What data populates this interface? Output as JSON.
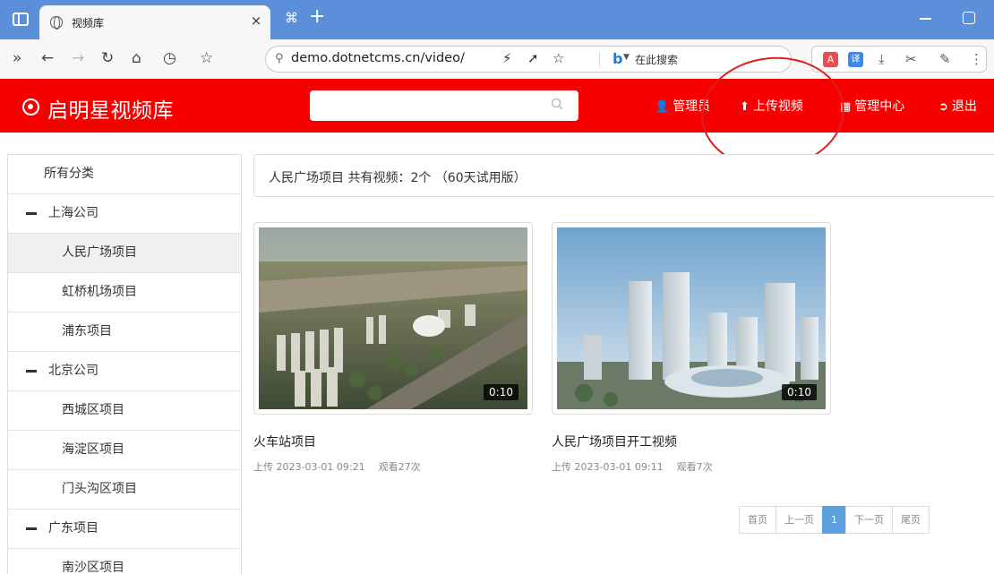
{
  "browser": {
    "tab_title": "视频库",
    "tab_close": "×",
    "new_tab": "+",
    "address_url": "demo.dotnetcms.cn/video/",
    "search_engine_text": "在此搜索"
  },
  "site": {
    "logo_text": "启明星视频库",
    "search_placeholder": "",
    "nav": [
      {
        "label": "管理员",
        "icon": "user-icon"
      },
      {
        "label": "上传视频",
        "icon": "upload-icon"
      },
      {
        "label": "管理中心",
        "icon": "dashboard-icon"
      },
      {
        "label": "退出",
        "icon": "logout-icon"
      }
    ]
  },
  "sidebar": {
    "all": "所有分类",
    "groups": [
      {
        "label": "上海公司",
        "items": [
          "人民广场项目",
          "虹桥机场项目",
          "浦东项目"
        ]
      },
      {
        "label": "北京公司",
        "items": [
          "西城区项目",
          "海淀区项目",
          "门头沟区项目"
        ]
      },
      {
        "label": "广东项目",
        "items": [
          "南沙区项目"
        ]
      }
    ],
    "active_item": "人民广场项目"
  },
  "main": {
    "crumb": "人民广场项目 共有视频：2个 （60天试用版）",
    "videos": [
      {
        "title": "火车站项目",
        "duration": "0:10",
        "uploaded": "上传 2023-03-01 09:21",
        "views": "观看27次"
      },
      {
        "title": "人民广场项目开工视频",
        "duration": "0:10",
        "uploaded": "上传 2023-03-01 09:11",
        "views": "观看7次"
      }
    ],
    "pager": {
      "first": "首页",
      "prev": "上一页",
      "current": "1",
      "next": "下一页",
      "last": "尾页"
    }
  },
  "colors": {
    "header_red": "#f60000",
    "browser_blue": "#5b8fd9",
    "pager_active": "#5b9fdc",
    "annotation_circle": "#d92020"
  }
}
